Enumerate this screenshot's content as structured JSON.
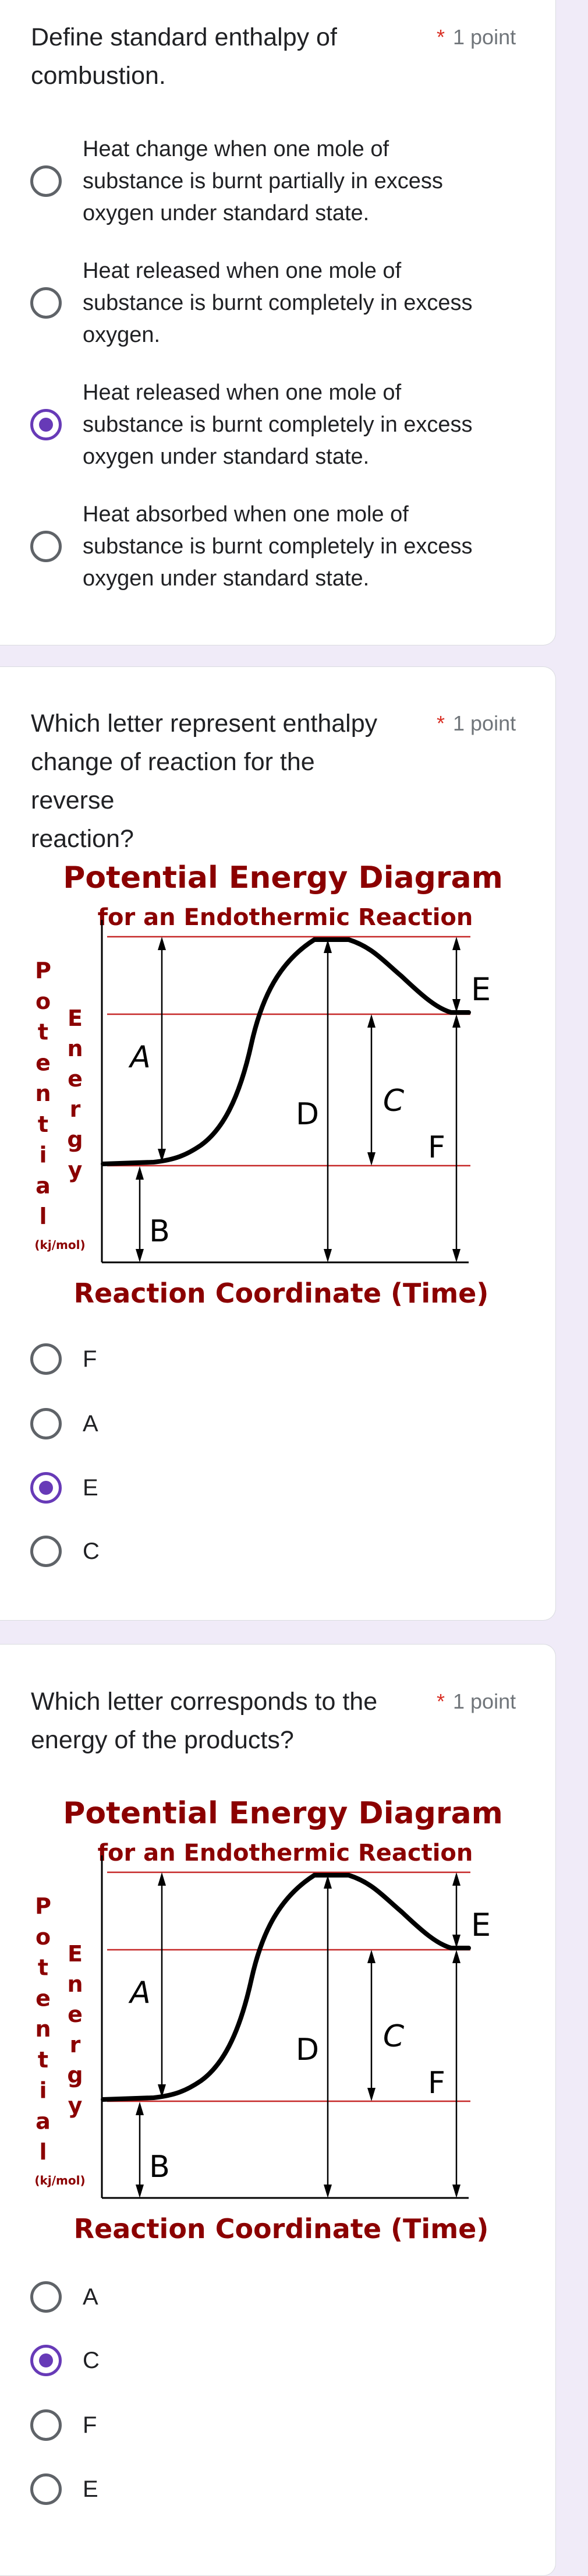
{
  "colors": {
    "accent": "#673ab7",
    "required": "#d93025",
    "diagram_text": "#8b0000",
    "background": "#f0ebf8"
  },
  "questions": [
    {
      "title_lines": [
        "Define standard enthalpy of",
        "combustion."
      ],
      "required_mark": "*",
      "points": "1 point",
      "options": [
        {
          "lines": [
            "Heat change when one mole of",
            "substance is burnt partially in excess",
            "oxygen under standard state."
          ],
          "selected": false
        },
        {
          "lines": [
            "Heat released when one mole of",
            "substance is burnt completely in excess",
            "oxygen."
          ],
          "selected": false
        },
        {
          "lines": [
            "Heat released when one mole of",
            "substance is burnt completely in excess",
            "oxygen under standard state."
          ],
          "selected": true
        },
        {
          "lines": [
            "Heat absorbed when one mole of",
            "substance is burnt completely in excess",
            "oxygen under standard state."
          ],
          "selected": false
        }
      ]
    },
    {
      "title_lines": [
        "Which letter represent enthalpy",
        "change of reaction for the reverse",
        "reaction?"
      ],
      "required_mark": "*",
      "points": "1 point",
      "options": [
        {
          "label": "F",
          "selected": false
        },
        {
          "label": "A",
          "selected": false
        },
        {
          "label": "E",
          "selected": true
        },
        {
          "label": "C",
          "selected": false
        }
      ]
    },
    {
      "title_lines": [
        "Which letter corresponds to the",
        "energy of the products?"
      ],
      "required_mark": "*",
      "points": "1 point",
      "options": [
        {
          "label": "A",
          "selected": false
        },
        {
          "label": "C",
          "selected": true
        },
        {
          "label": "F",
          "selected": false
        },
        {
          "label": "E",
          "selected": false
        }
      ]
    }
  ],
  "diagram": {
    "title": "Potential Energy Diagram",
    "subtitle": "for an Endothermic Reaction",
    "y_label_1": "Potential",
    "y_label_2": "Energy",
    "y_unit": "(kj/mol)",
    "x_label": "Reaction Coordinate (Time)",
    "labels": {
      "A": "A",
      "B": "B",
      "C": "C",
      "D": "D",
      "E": "E",
      "F": "F"
    }
  }
}
